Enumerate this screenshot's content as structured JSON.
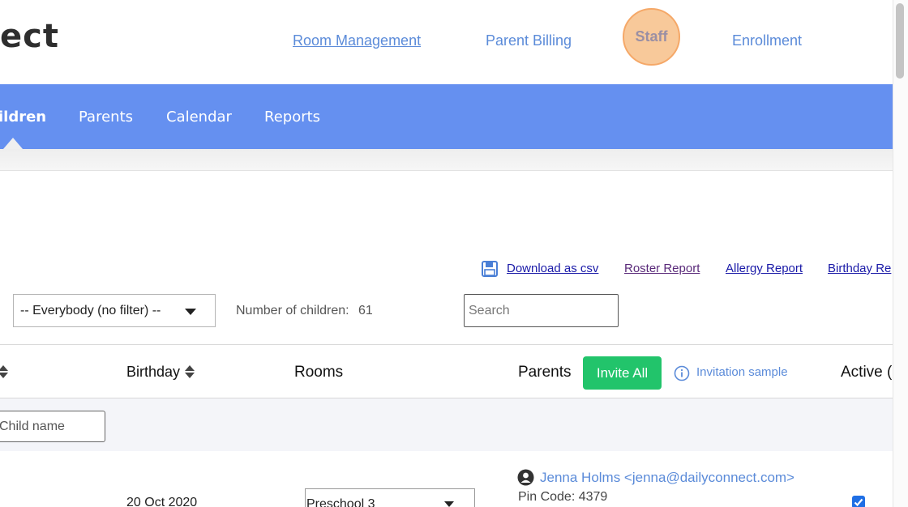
{
  "brand": {
    "logo_text": "ect"
  },
  "top_nav": {
    "room_management": "Room Management",
    "parent_billing": "Parent Billing",
    "staff": "Staff",
    "enrollment": "Enrollment"
  },
  "tabs": {
    "children": "ildren",
    "parents": "Parents",
    "calendar": "Calendar",
    "reports": "Reports"
  },
  "reports": {
    "download_csv": "Download as csv",
    "roster": "Roster Report",
    "allergy": "Allergy Report",
    "birthday": "Birthday Re"
  },
  "filter": {
    "selected": "-- Everybody (no filter) --",
    "count_label": "Number of children:",
    "count_value": "61",
    "search_placeholder": "Search"
  },
  "table": {
    "headers": {
      "birthday": "Birthday",
      "rooms": "Rooms",
      "parents": "Parents",
      "invite_all": "Invite All",
      "invitation_sample": "Invitation sample",
      "active": "Active ("
    },
    "child_name_placeholder": "Child name",
    "rows": [
      {
        "birthday": "20 Oct 2020",
        "room": "Preschool 3",
        "parent": "Jenna Holms <jenna@dailyconnect.com>",
        "pin": "Pin Code: 4379",
        "active": true
      }
    ]
  },
  "colors": {
    "nav_bg": "#6590f0",
    "link": "#5b8bd9",
    "invite_green": "#22c46b",
    "staff_highlight": "#f8c99a"
  }
}
